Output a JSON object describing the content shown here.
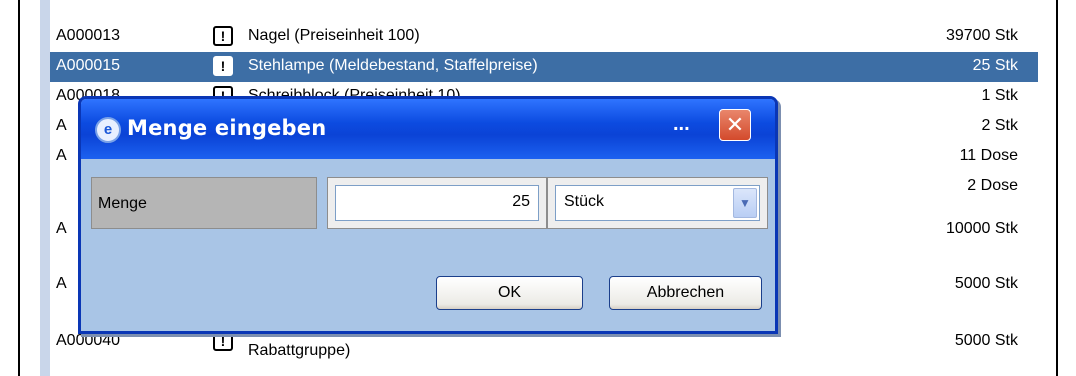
{
  "list": {
    "rows": [
      {
        "id": "A000013",
        "desc": "Nagel (Preiseinheit 100)",
        "qty": "39700 Stk"
      },
      {
        "id": "A000015",
        "desc": "Stehlampe (Meldebestand, Staffelpreise)",
        "qty": "25 Stk"
      },
      {
        "id": "A000018",
        "desc": "Schreibblock (Preiseinheit 10)",
        "qty": "1 Stk"
      },
      {
        "id": "A",
        "desc": "",
        "qty": "2 Stk"
      },
      {
        "id": "A",
        "desc": "",
        "qty": "11 Dose"
      },
      {
        "id": "",
        "desc": "",
        "qty": "2 Dose"
      },
      {
        "id": "A",
        "desc": "",
        "qty": "10000 Stk"
      },
      {
        "id": "A",
        "desc": "",
        "qty": "5000 Stk"
      },
      {
        "id": "A000040",
        "desc": "",
        "desc2": "Rabattgruppe)",
        "qty": "5000 Stk"
      }
    ],
    "selected_index": 1
  },
  "dialog": {
    "title": "Menge eingeben",
    "title_dots": "...",
    "close_glyph": "✕",
    "field_label": "Menge",
    "quantity_value": "25",
    "unit_selected": "Stück",
    "ok_label": "OK",
    "cancel_label": "Abbrechen"
  },
  "icons": {
    "warning": "!",
    "app": "e",
    "dropdown": "▼"
  }
}
